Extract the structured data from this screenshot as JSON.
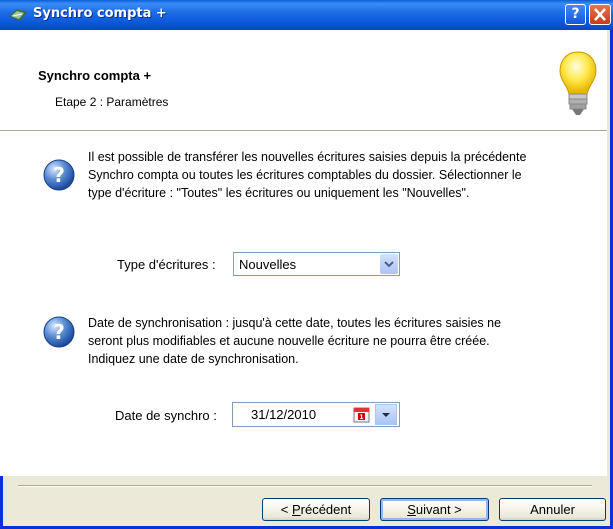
{
  "window": {
    "title": "Synchro compta +",
    "help_label": "?",
    "close_label": "✕"
  },
  "header": {
    "title": "Synchro compta +",
    "subtitle": "Etape 2 : Paramètres",
    "icon": "lightbulb-icon"
  },
  "section1": {
    "icon": "question-icon",
    "lines": [
      "Il est possible de transférer les nouvelles écritures saisies depuis la précédente",
      "Synchro compta ou toutes les écritures comptables du dossier. Sélectionner le",
      "type d'écriture : \"Toutes\" les écritures ou uniquement les \"Nouvelles\"."
    ],
    "field_label": "Type d'écritures :",
    "field_value": "Nouvelles"
  },
  "section2": {
    "icon": "question-icon",
    "lines": [
      "Date de synchronisation : jusqu'à cette date, toutes les écritures saisies ne",
      "seront plus modifiables et aucune nouvelle écriture ne pourra être créée.",
      "Indiquez une date de synchronisation."
    ],
    "field_label": "Date de synchro :",
    "field_value": "31/12/2010",
    "calendar_icon": "calendar-icon"
  },
  "buttons": {
    "prev_prefix": "< ",
    "prev_mnemonic": "P",
    "prev_rest": "récédent",
    "next_mnemonic": "S",
    "next_rest": "uivant >",
    "cancel": "Annuler"
  },
  "colors": {
    "titlebar": "#0a55d4",
    "window_frame": "#0831d9",
    "button_border": "#003c74"
  }
}
